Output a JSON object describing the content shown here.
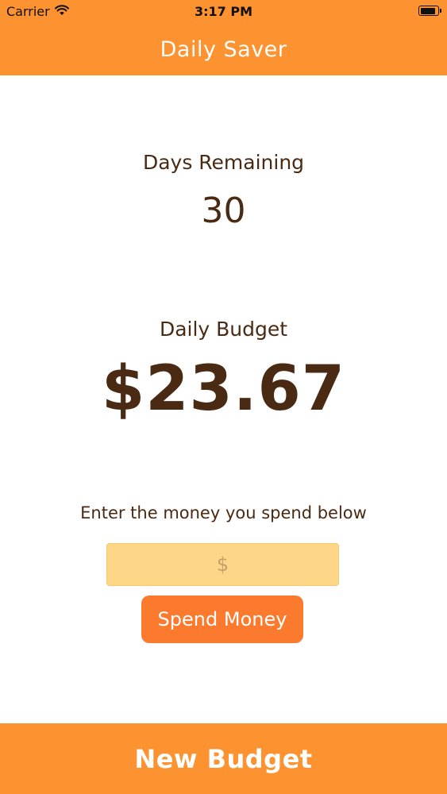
{
  "status_bar": {
    "carrier": "Carrier",
    "time": "3:17 PM",
    "wifi_icon": "wifi-icon",
    "battery_icon": "battery-icon"
  },
  "nav": {
    "title": "Daily Saver"
  },
  "days": {
    "label": "Days Remaining",
    "value": "30"
  },
  "budget": {
    "label": "Daily Budget",
    "value": "$23.67"
  },
  "spend": {
    "prompt": "Enter the money you spend below",
    "input_placeholder": "$",
    "input_value": "",
    "button_label": "Spend Money"
  },
  "footer": {
    "new_budget_label": "New Budget"
  },
  "colors": {
    "accent": "#fd9230",
    "button": "#fb7a2e",
    "input_bg": "#fdd787",
    "text": "#4a2a12"
  }
}
